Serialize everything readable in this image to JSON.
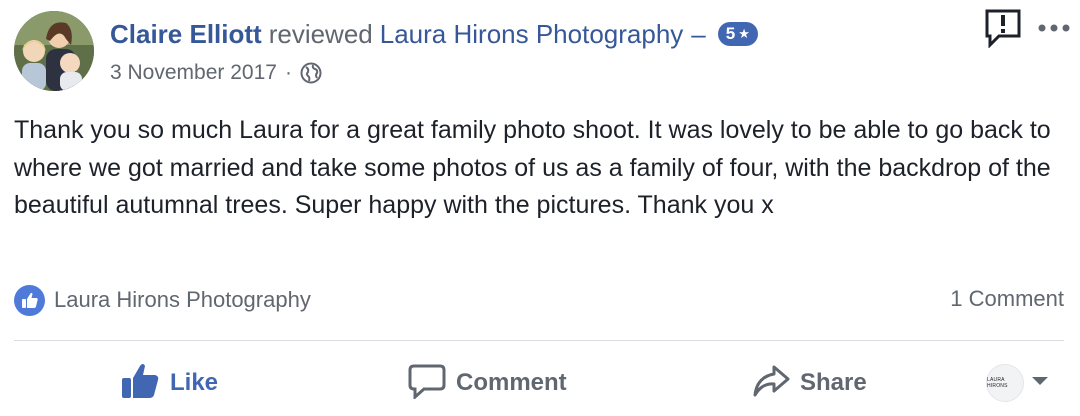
{
  "review": {
    "author": "Claire Elliott",
    "verb": "reviewed",
    "page_name": "Laura Hirons Photography",
    "dash": "–",
    "rating": "5",
    "rating_star": "★",
    "date": "3 November 2017",
    "separator": "·",
    "audience_icon": "globe-icon",
    "text": "Thank you so much Laura for a great family photo shoot. It was lovely to be able to go back to where we got married and take some photos of us as a family of four, with the backdrop of the beautiful autumnal trees. Super happy with the pictures. Thank you x"
  },
  "reactions": {
    "icon": "thumbs-up-icon",
    "liked_by": "Laura Hirons Photography",
    "comment_count": "1 Comment"
  },
  "actions": {
    "like": "Like",
    "comment": "Comment",
    "share": "Share",
    "page_avatar_text": "LAURA HIRONS"
  },
  "colors": {
    "link": "#365899",
    "accent": "#4267b2",
    "muted": "#616770",
    "divider": "#dadde1"
  }
}
